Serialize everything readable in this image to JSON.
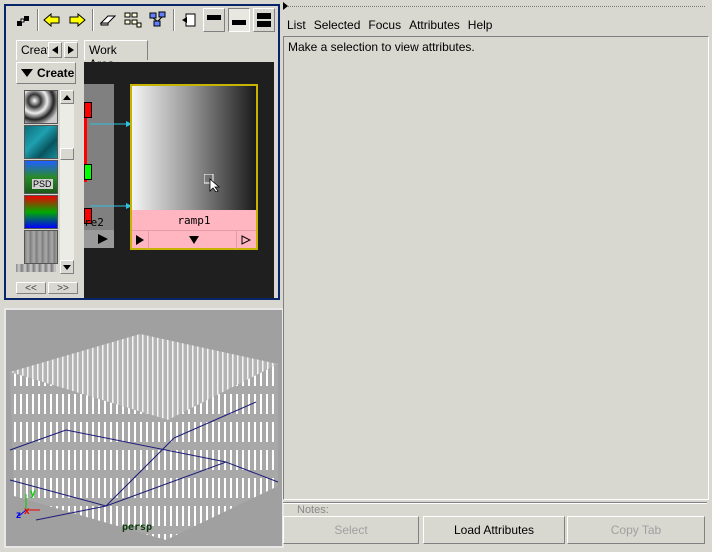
{
  "toolbar": {
    "buttons": [
      "graph-icon",
      "arrow-left-icon",
      "arrow-right-icon",
      "eraser-icon",
      "grid-icon",
      "network-icon",
      "input-output-icon",
      "layout-top-icon",
      "layout-bottom-icon",
      "layout-split-icon"
    ]
  },
  "tabs": {
    "create_tab": "Creat",
    "work_area_tab": "Work Area"
  },
  "create_panel": {
    "dropdown_label": "Create",
    "psd_label": "PSD",
    "nav_left": "<<",
    "nav_right": ">>"
  },
  "work_area": {
    "partial_node_label": "re2",
    "ramp_node_label": "ramp1"
  },
  "attribute_editor": {
    "menu": [
      "List",
      "Selected",
      "Focus",
      "Attributes",
      "Help"
    ],
    "message": "Make a selection to view attributes.",
    "notes_label": "Notes:",
    "buttons": {
      "select": "Select",
      "load_attributes": "Load Attributes",
      "copy_tab": "Copy Tab"
    }
  },
  "viewport": {
    "camera_label": "persp",
    "axes": {
      "x": "x",
      "y": "y",
      "z": "z"
    }
  },
  "colors": {
    "panel_bg": "#d8d8d0",
    "active_border": "#0a246a",
    "node_pink": "#ffb6c1",
    "node_select": "#c8b400",
    "connection": "#30c0e0"
  }
}
